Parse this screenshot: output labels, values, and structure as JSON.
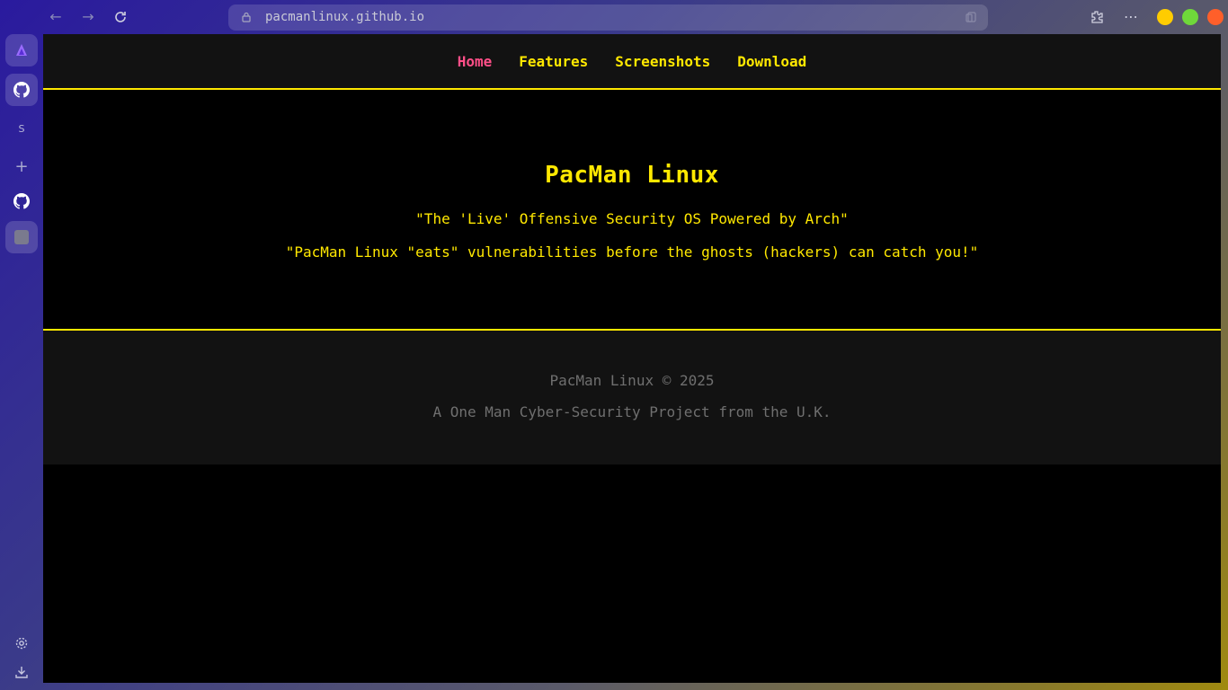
{
  "browser": {
    "url": "pacmanlinux.github.io",
    "sidebar": {
      "letter_item": "S"
    },
    "traffic_lights": {
      "minimize": "#ffcc00",
      "maximize": "#6fd83a",
      "close": "#ff5f2a"
    }
  },
  "site": {
    "nav": {
      "home": "Home",
      "features": "Features",
      "screenshots": "Screenshots",
      "download": "Download"
    },
    "hero": {
      "title": "PacMan Linux",
      "tagline1": "\"The 'Live' Offensive Security OS Powered by Arch\"",
      "tagline2": "\"PacMan Linux \"eats\" vulnerabilities before the ghosts (hackers) can catch you!\""
    },
    "footer": {
      "copyright": "PacMan Linux © 2025",
      "subtitle": "A One Man Cyber-Security Project from the U.K."
    },
    "colors": {
      "accent": "#ffe800",
      "active_nav": "#ff4f88",
      "nav_bg": "#121212",
      "footer_text": "#6f6f6f"
    }
  }
}
